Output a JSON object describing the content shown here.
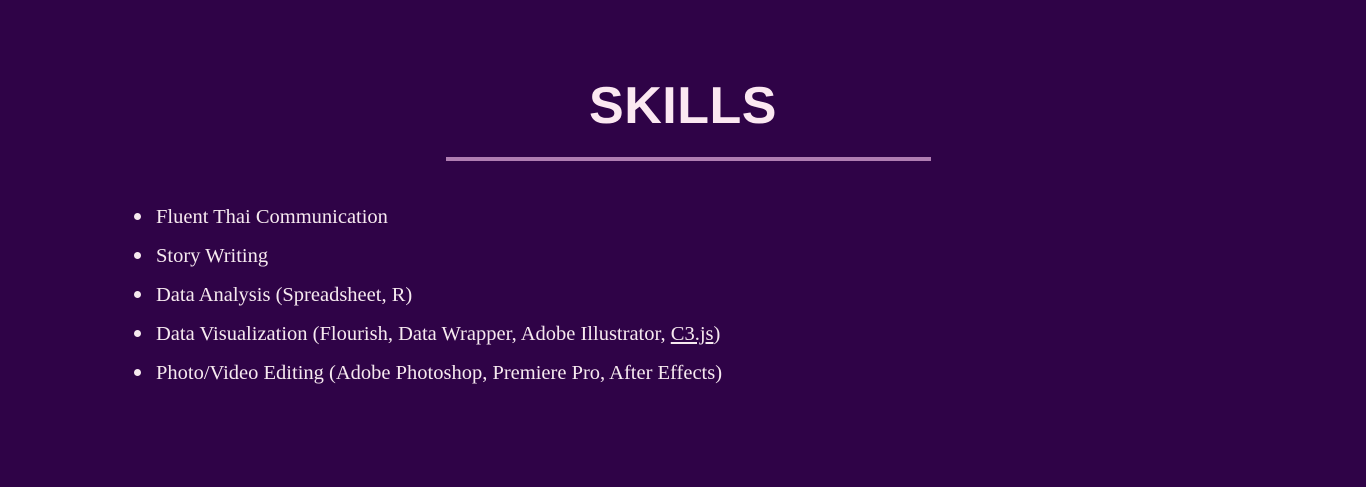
{
  "section": {
    "title": "SKILLS",
    "skills": [
      {
        "text": "Fluent Thai Communication"
      },
      {
        "text": "Story Writing"
      },
      {
        "text": "Data Analysis (Spreadsheet, R)"
      },
      {
        "text_before": "Data Visualization (Flourish, Data Wrapper, Adobe Illustrator, ",
        "link": "C3.js",
        "text_after": ")"
      },
      {
        "text": "Photo/Video Editing (Adobe Photoshop, Premiere Pro, After Effects)"
      }
    ]
  },
  "colors": {
    "background": "#2f0347",
    "text": "#f6e9ef",
    "divider": "#b07eb2"
  }
}
